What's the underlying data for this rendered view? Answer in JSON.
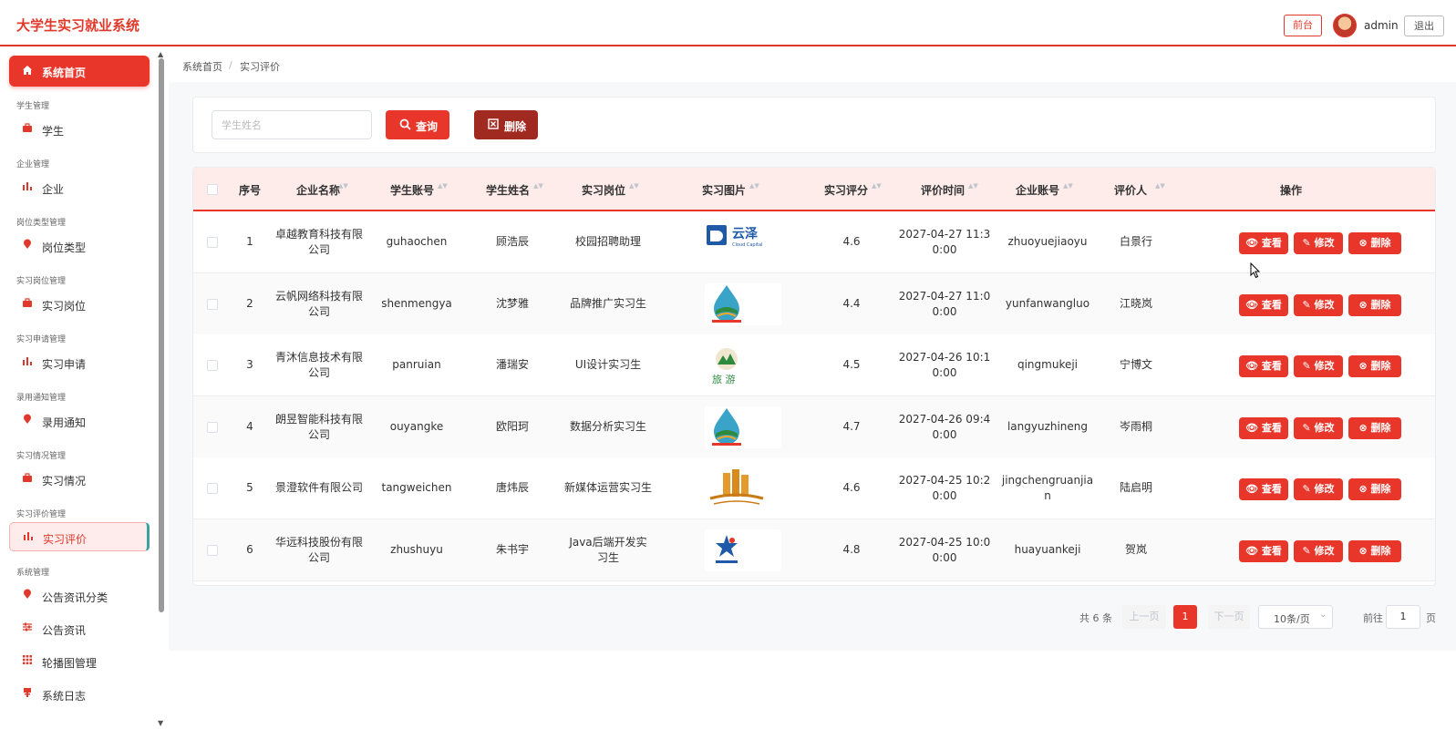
{
  "app": {
    "title": "大学生实习就业系统"
  },
  "header": {
    "front_label": "前台",
    "user": "admin",
    "logout_label": "退出"
  },
  "sidebar": {
    "home": "系统首页",
    "groups": [
      {
        "title": "学生管理",
        "item": "学生",
        "icon": "briefcase-icon"
      },
      {
        "title": "企业管理",
        "item": "企业",
        "icon": "bar-chart-icon"
      },
      {
        "title": "岗位类型管理",
        "item": "岗位类型",
        "icon": "location-pin-icon"
      },
      {
        "title": "实习岗位管理",
        "item": "实习岗位",
        "icon": "briefcase-icon"
      },
      {
        "title": "实习申请管理",
        "item": "实习申请",
        "icon": "bar-chart-icon"
      },
      {
        "title": "录用通知管理",
        "item": "录用通知",
        "icon": "location-pin-icon"
      },
      {
        "title": "实习情况管理",
        "item": "实习情况",
        "icon": "briefcase-icon"
      },
      {
        "title": "实习评价管理",
        "item": "实习评价",
        "icon": "bar-chart-icon"
      },
      {
        "title": "系统管理",
        "item": "公告资讯分类",
        "icon": "location-pin-icon"
      }
    ],
    "extra_items": [
      {
        "item": "公告资讯",
        "icon": "sliders-icon"
      },
      {
        "item": "轮播图管理",
        "icon": "grid-icon"
      },
      {
        "item": "系统日志",
        "icon": "flag-icon"
      }
    ],
    "active": "实习评价",
    "accent_color": "#e8362a"
  },
  "breadcrumb": {
    "home": "系统首页",
    "separator": "/",
    "current": "实习评价"
  },
  "search": {
    "placeholder": "学生姓名",
    "query_label": "查询",
    "delete_label": "删除"
  },
  "table": {
    "columns": [
      "序号",
      "企业名称",
      "学生账号",
      "学生姓名",
      "实习岗位",
      "实习图片",
      "实习评分",
      "评价时间",
      "企业账号",
      "评价人",
      "操作"
    ],
    "rows": [
      {
        "no": "1",
        "company": [
          "卓越教育科技有限",
          "公司"
        ],
        "student_account": "guhaochen",
        "student_name": "顾浩辰",
        "position": [
          "校园招聘助理"
        ],
        "image": "logo-yunze",
        "score": "4.6",
        "time": [
          "2027-04-27 11:3",
          "0:00"
        ],
        "company_account": [
          "zhuoyuejiaoyu"
        ],
        "reviewer": "白景行"
      },
      {
        "no": "2",
        "company": [
          "云帆网络科技有限",
          "公司"
        ],
        "student_account": "shenmengya",
        "student_name": "沈梦雅",
        "position": [
          "品牌推广实习生"
        ],
        "image": "logo-water-drop",
        "score": "4.4",
        "time": [
          "2027-04-27 11:0",
          "0:00"
        ],
        "company_account": [
          "yunfanwangluo"
        ],
        "reviewer": "江晓岚"
      },
      {
        "no": "3",
        "company": [
          "青沐信息技术有限",
          "公司"
        ],
        "student_account": "panruian",
        "student_name": "潘瑞安",
        "position": [
          "UI设计实习生"
        ],
        "image": "logo-travel",
        "score": "4.5",
        "time": [
          "2027-04-26 10:1",
          "0:00"
        ],
        "company_account": [
          "qingmukeji"
        ],
        "reviewer": "宁博文"
      },
      {
        "no": "4",
        "company": [
          "朗昱智能科技有限",
          "公司"
        ],
        "student_account": "ouyangke",
        "student_name": "欧阳珂",
        "position": [
          "数据分析实习生"
        ],
        "image": "logo-water-drop",
        "score": "4.7",
        "time": [
          "2027-04-26 09:4",
          "0:00"
        ],
        "company_account": [
          "langyuzhineng"
        ],
        "reviewer": "岑雨桐"
      },
      {
        "no": "5",
        "company": [
          "景澄软件有限公司"
        ],
        "student_account": "tangweichen",
        "student_name": "唐炜辰",
        "position": [
          "新媒体运营实习生"
        ],
        "image": "logo-building",
        "score": "4.6",
        "time": [
          "2027-04-25 10:2",
          "0:00"
        ],
        "company_account": [
          "jingchengruanjia",
          "n"
        ],
        "reviewer": "陆启明"
      },
      {
        "no": "6",
        "company": [
          "华远科技股份有限",
          "公司"
        ],
        "student_account": "zhushuyu",
        "student_name": "朱书宇",
        "position": [
          "Java后端开发实",
          "习生"
        ],
        "image": "logo-star",
        "score": "4.8",
        "time": [
          "2027-04-25 10:0",
          "0:00"
        ],
        "company_account": [
          "huayuankeji"
        ],
        "reviewer": "贺岚"
      }
    ],
    "actions": {
      "view": "查看",
      "edit": "修改",
      "delete": "删除"
    },
    "logo_texts": {
      "yunze": "云泽",
      "yunze_sub": "Cloud Capital",
      "travel": "旅 游"
    }
  },
  "pagination": {
    "total": "共 6 条",
    "prev": "上一页",
    "page": "1",
    "next": "下一页",
    "page_size": "10条/页",
    "goto": "前往",
    "goto_value": "1",
    "page_unit": "页"
  }
}
